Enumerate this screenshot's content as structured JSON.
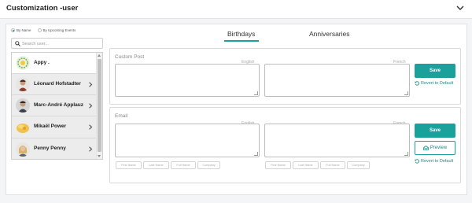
{
  "header": {
    "title": "Customization -user"
  },
  "filters": {
    "by_name": "By Name",
    "by_events": "By Upcoming Events"
  },
  "search": {
    "placeholder": "Search user..."
  },
  "users": [
    {
      "name": "Appy ."
    },
    {
      "name": "Léonard Hofstadter"
    },
    {
      "name": "Marc-André Applauz"
    },
    {
      "name": "Mikaël Power"
    },
    {
      "name": "Penny Penny"
    }
  ],
  "tabs": [
    {
      "label": "Birthdays",
      "active": true
    },
    {
      "label": "Anniversaries",
      "active": false
    }
  ],
  "custom_post": {
    "title": "Custom Post",
    "english_label": "English",
    "french_label": "French",
    "save_label": "Save",
    "revert_label": "Revert to Default"
  },
  "email": {
    "title": "Email",
    "english_label": "English",
    "french_label": "French",
    "save_label": "Save",
    "preview_label": "Preview",
    "revert_label": "Revert to Default",
    "english_chips": [
      "First Name",
      "Last Name",
      "Full Name",
      "Company"
    ],
    "french_chips": [
      "First Name",
      "Last Name",
      "Full Name",
      "Company"
    ]
  },
  "colors": {
    "accent": "#1aa19c"
  }
}
